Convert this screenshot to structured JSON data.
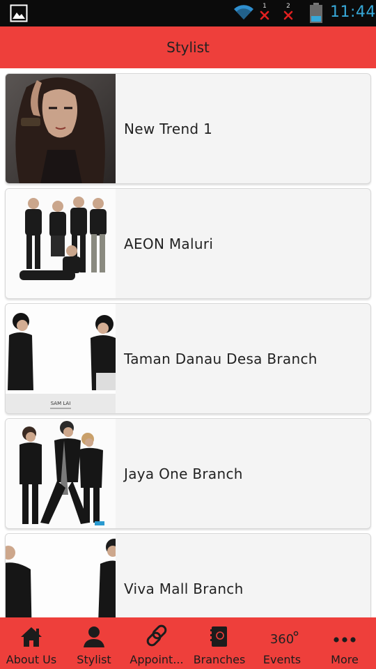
{
  "status_bar": {
    "sim1": "1",
    "sim2": "2",
    "time": "11:44",
    "icons": [
      "gallery-icon",
      "wifi-icon",
      "no-signal-icon",
      "no-signal-icon",
      "battery-icon"
    ],
    "clock_color": "#37a8d8"
  },
  "header": {
    "title": "Stylist",
    "color": "#ee3f3b"
  },
  "branches": [
    {
      "label": "New Trend 1"
    },
    {
      "label": "AEON Maluri"
    },
    {
      "label": "Taman Danau Desa Branch",
      "photo_caption": "SAM LAI"
    },
    {
      "label": "Jaya One Branch"
    },
    {
      "label": "Viva Mall Branch"
    }
  ],
  "bottom_nav": {
    "items": [
      {
        "label": "About Us",
        "icon": "home-icon"
      },
      {
        "label": "Stylist",
        "icon": "person-icon"
      },
      {
        "label": "Appoint...",
        "icon": "link-icon"
      },
      {
        "label": "Branches",
        "icon": "book-icon"
      },
      {
        "label": "Events",
        "icon": "360-icon",
        "icon_text": "360"
      },
      {
        "label": "More",
        "icon": "more-icon"
      }
    ]
  }
}
